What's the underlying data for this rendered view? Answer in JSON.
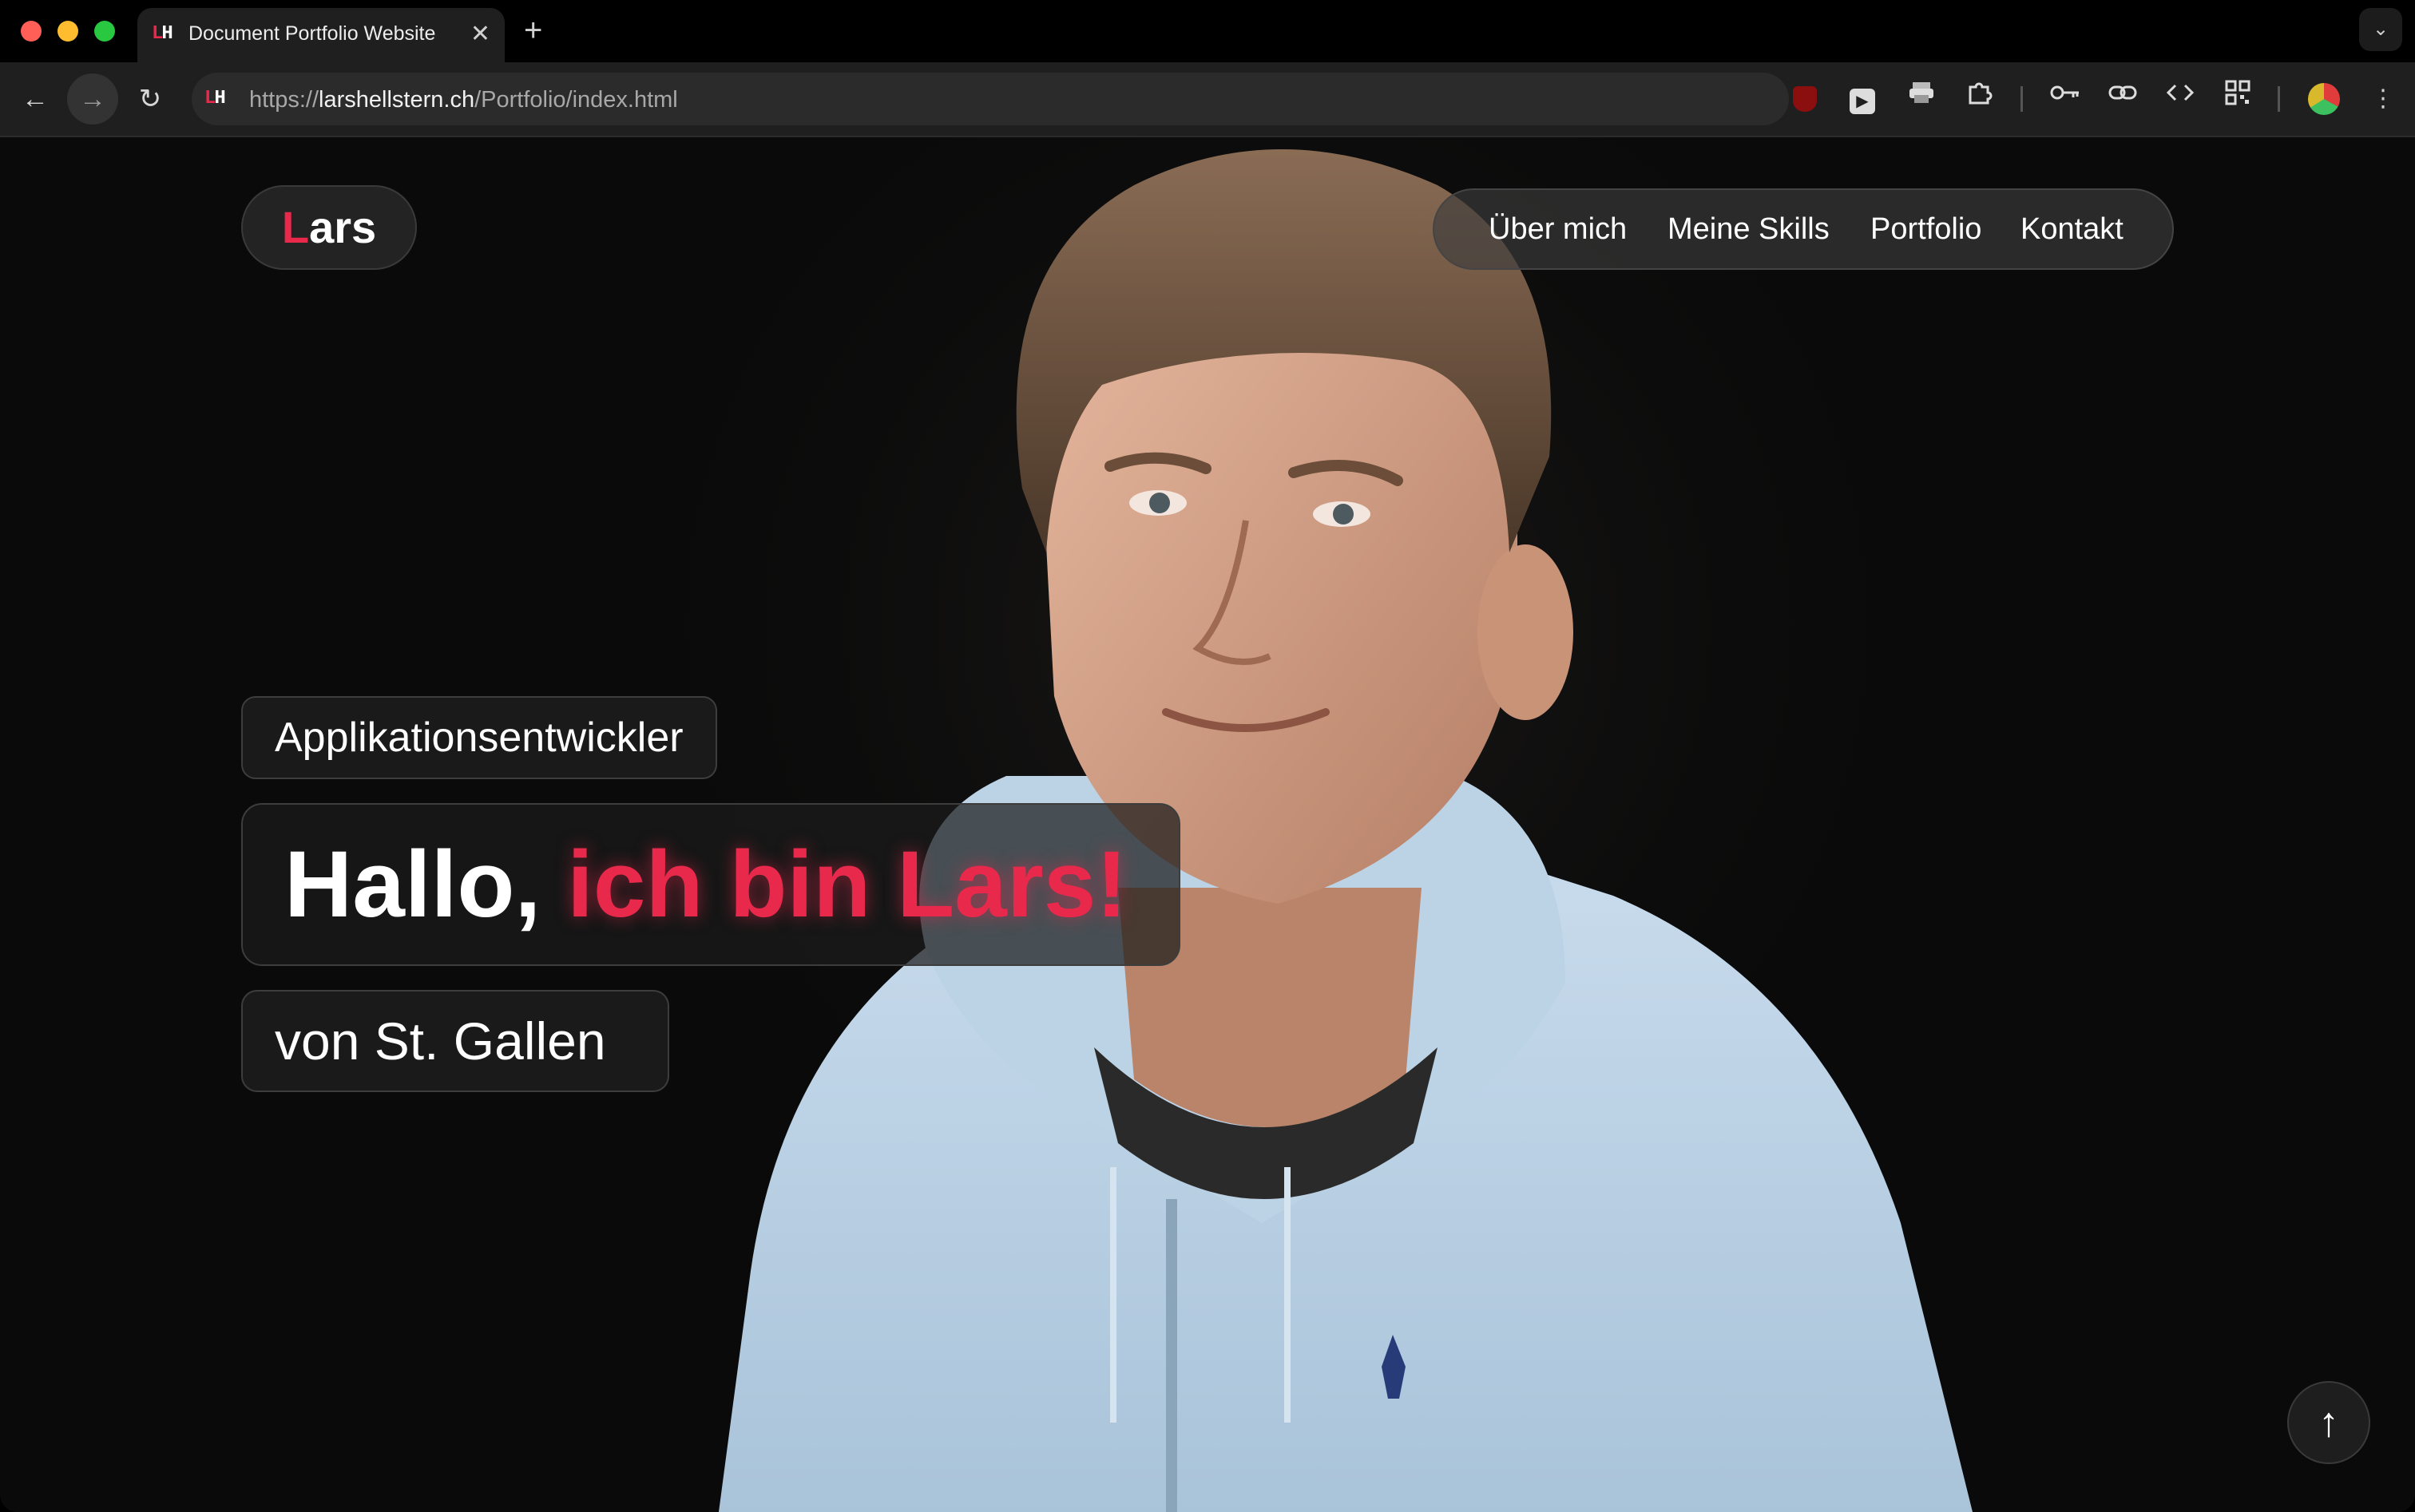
{
  "browser": {
    "tab_title": "Document Portfolio Website",
    "tab_favicon": "LH",
    "url_scheme": "https://",
    "url_host": "larshellstern.ch",
    "url_path": "/Portfolio/index.html",
    "icons": [
      "back-arrow-icon",
      "forward-arrow-icon",
      "reload-icon",
      "ublock-icon",
      "play-extension-icon",
      "print-icon",
      "extensions-puzzle-icon",
      "password-key-icon",
      "link-icon",
      "code-icon",
      "qr-code-icon",
      "profile-avatar-icon",
      "more-menu-icon"
    ]
  },
  "site": {
    "logo_accent": "L",
    "logo_rest": "ars",
    "nav": [
      "Über mich",
      "Meine Skills",
      "Portfolio",
      "Kontakt"
    ],
    "role": "Applikationsentwickler",
    "hero_plain": "Hallo, ",
    "hero_accent": "ich bin Lars!",
    "city": "von St. Gallen",
    "accent_color": "#e8294c"
  }
}
